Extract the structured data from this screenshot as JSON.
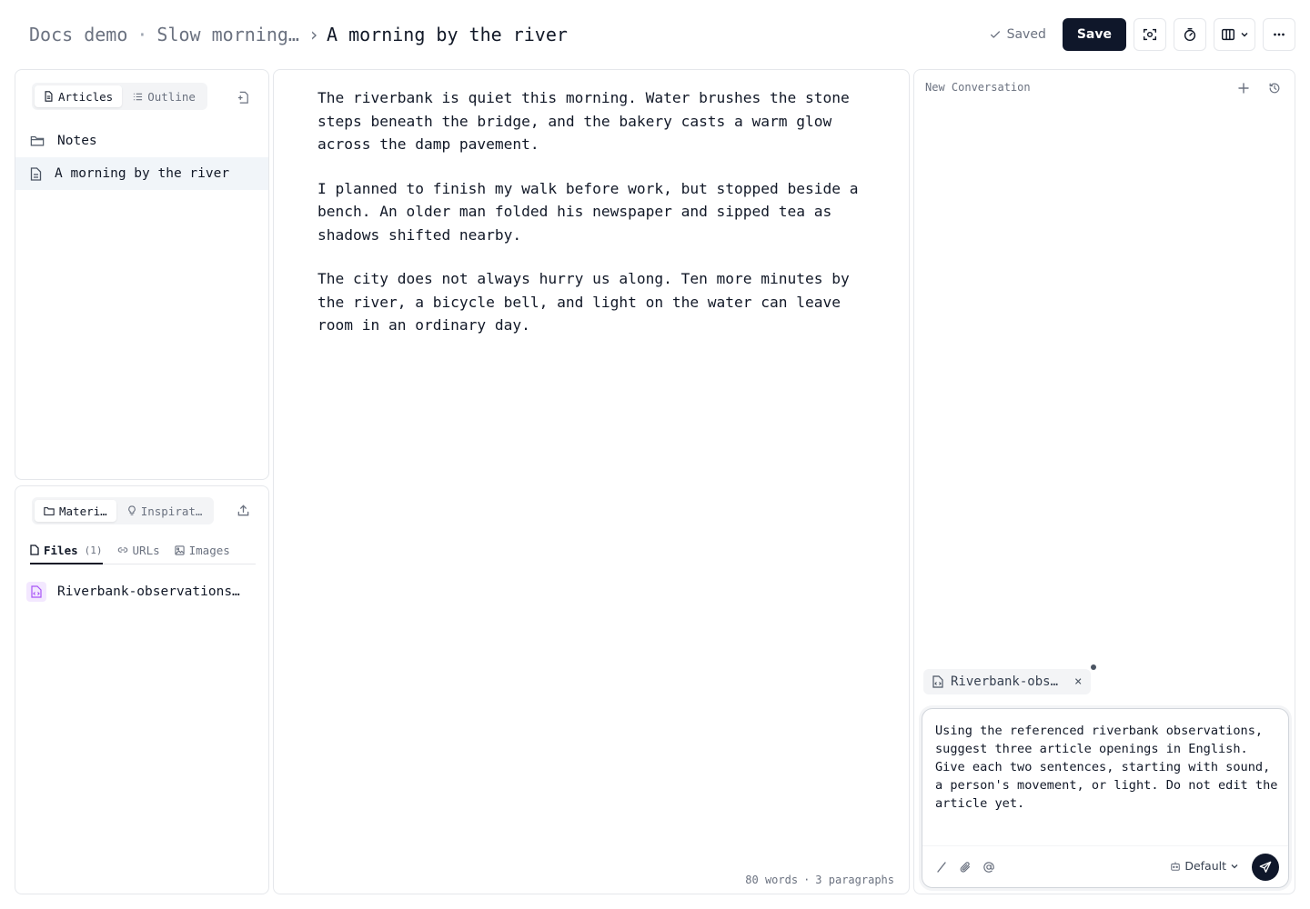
{
  "header": {
    "breadcrumb": {
      "workspace": "Docs demo",
      "separator": "·",
      "project": "Slow morning…",
      "arrow": "›",
      "current": "A morning by the river"
    },
    "status": "Saved",
    "save_label": "Save"
  },
  "articles_panel": {
    "tabs": [
      {
        "label": "Articles",
        "icon": "document-icon",
        "active": true
      },
      {
        "label": "Outline",
        "icon": "list-icon",
        "active": false
      }
    ],
    "items": [
      {
        "label": "Notes",
        "icon": "folder-icon",
        "selected": false
      },
      {
        "label": "A morning by the river",
        "icon": "document-icon",
        "selected": true
      }
    ]
  },
  "materials_panel": {
    "tabs": [
      {
        "label": "Materi…",
        "icon": "folder-icon",
        "active": true
      },
      {
        "label": "Inspirat…",
        "icon": "lightbulb-icon",
        "active": false
      }
    ],
    "subtabs": [
      {
        "label": "Files",
        "count": "(1)",
        "icon": "file-icon",
        "active": true
      },
      {
        "label": "URLs",
        "icon": "link-icon",
        "active": false
      },
      {
        "label": "Images",
        "icon": "image-icon",
        "active": false
      }
    ],
    "files": [
      {
        "name": "Riverbank-observations…",
        "icon": "code-file-icon"
      }
    ]
  },
  "editor": {
    "paragraphs": [
      "The riverbank is quiet this morning. Water brushes the stone steps beneath the bridge, and the bakery casts a warm glow across the damp pavement.",
      "I planned to finish my walk before work, but stopped beside a bench. An older man folded his newspaper and sipped tea as shadows shifted nearby.",
      "The city does not always hurry us along. Ten more minutes by the river, a bicycle bell, and light on the water can leave room in an ordinary day."
    ],
    "word_count": "80 words",
    "separator": "·",
    "paragraph_count": "3 paragraphs"
  },
  "chat": {
    "title": "New Conversation",
    "reference_chip": "Riverbank-obs…",
    "reference_close": "×",
    "composer_text": "Using the referenced riverbank observations, suggest three article openings in English. Give each two sentences, starting with sound, a person's movement, or light. Do not edit the article yet.",
    "model": "Default"
  },
  "colors": {
    "accent": "#0f172a",
    "muted_text": "#6b7280",
    "border": "#e5e7eb",
    "selected_row": "#f1f5f9",
    "file_badge": "#f3e8ff",
    "file_badge_icon": "#a855f7"
  }
}
